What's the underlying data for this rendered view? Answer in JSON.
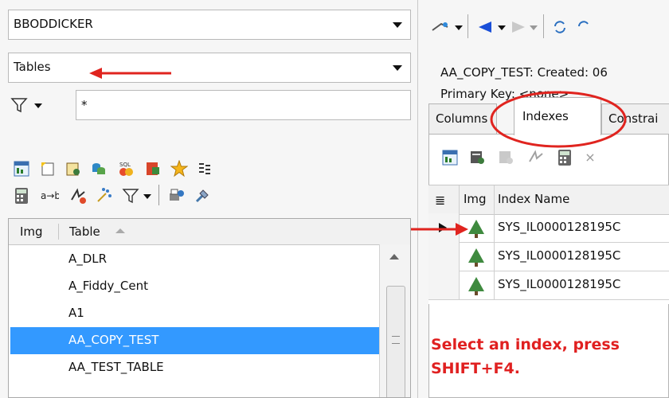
{
  "left": {
    "schema_combo": {
      "value": "BBODDICKER"
    },
    "type_combo": {
      "value": "Tables"
    },
    "filter": {
      "value": "*"
    },
    "grid": {
      "headers": {
        "img": "Img",
        "table": "Table"
      },
      "rows": [
        "A_DLR",
        "A_Fiddy_Cent",
        "A1",
        "AA_COPY_TEST",
        "AA_TEST_TABLE"
      ],
      "selected": "AA_COPY_TEST"
    }
  },
  "right": {
    "title": "AA_COPY_TEST:  Created: 06",
    "primary_key": "Primary Key:  <none>",
    "tabs": [
      "Columns",
      "Indexes",
      "Constrai"
    ],
    "active_tab": "Indexes",
    "index_grid": {
      "headers": {
        "img": "Img",
        "name": "Index Name"
      },
      "rows": [
        "SYS_IL0000128195C",
        "SYS_IL0000128195C",
        "SYS_IL0000128195C"
      ]
    },
    "message_line1": "Select an index, press",
    "message_line2": "SHIFT+F4."
  },
  "colors": {
    "selection": "#3399ff",
    "annotation": "#e0241f",
    "message": "#e02020"
  },
  "icons": [
    "filter-icon",
    "table-grid-icon",
    "new-table-icon",
    "script-icon",
    "copy-icon",
    "sql-icon",
    "export-icon",
    "star-icon",
    "compare-icon",
    "calculator-icon",
    "find-replace-icon",
    "refresh-icon",
    "filter-funnel-icon",
    "print-icon",
    "wrench-icon",
    "back-arrow-icon",
    "forward-arrow-icon",
    "tree-index-icon"
  ]
}
